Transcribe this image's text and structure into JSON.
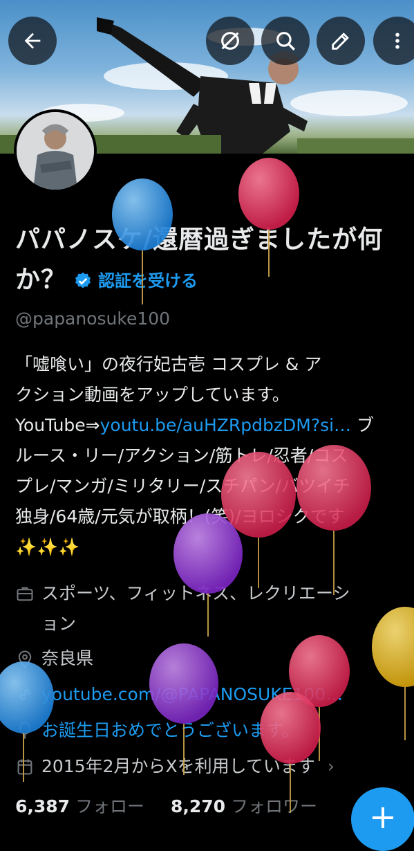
{
  "header": {
    "back_icon": "arrow-left-icon",
    "icons": [
      "hide-icon",
      "search-icon",
      "edit-icon",
      "more-vertical-icon"
    ]
  },
  "profile": {
    "name": "パパノスケ/還暦過ぎましたが何か？",
    "verify_label": "認証を受ける",
    "handle": "@papanosuke100"
  },
  "bio": {
    "line1": "「嘘喰い」の夜行妃古壱 コスプレ & ア",
    "line2": "クション動画をアップしています。",
    "youtube_prefix": "YouTube⇒",
    "youtube_link": "youtu.be/auHZRpdbzDM?si…",
    "line3_suffix": " ブ",
    "line4": "ルース・リー/アクション/筋トレ/忍者/コス",
    "line5": "プレ/マンガ/ミリタリー/スチパン/バツイチ",
    "line6": "独身/64歳/元気が取柄！(笑)/ヨロシクです",
    "line7": "✨✨✨"
  },
  "meta": {
    "category": "スポーツ、フィットネス、レクリエーシ",
    "category_2": "ョン",
    "location": "奈良県",
    "website": "youtube.com/@PAPANOSUKE100…",
    "birthday": "お誕生日おめでとうございます。",
    "joined": "2015年2月からXを利用しています",
    "joined_chevron": "›"
  },
  "stats": {
    "following_count": "6,387",
    "following_label": "フォロー",
    "followers_count": "8,270",
    "followers_label": "フォロワー"
  },
  "fab": {
    "label": "+"
  },
  "colors": {
    "accent": "#1d9bf0",
    "bg": "#000000",
    "muted": "#71767b"
  }
}
